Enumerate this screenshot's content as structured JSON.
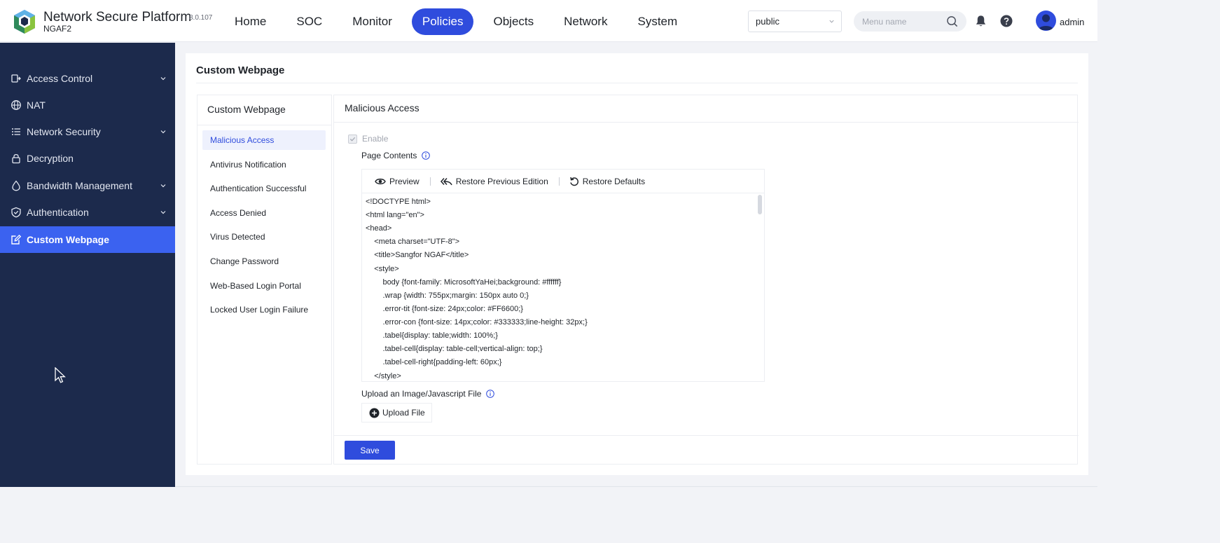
{
  "header": {
    "title": "Network Secure Platform",
    "subtitle": "NGAF2",
    "version": "8.0.107",
    "nav": [
      "Home",
      "SOC",
      "Monitor",
      "Policies",
      "Objects",
      "Network",
      "System"
    ],
    "active_nav": "Policies",
    "workspace_select": "public",
    "search_placeholder": "Menu name",
    "username": "admin"
  },
  "sidebar": {
    "items": [
      {
        "label": "Access Control",
        "icon": "access-control-icon",
        "expandable": true
      },
      {
        "label": "NAT",
        "icon": "globe-icon",
        "expandable": false
      },
      {
        "label": "Network Security",
        "icon": "list-icon",
        "expandable": true
      },
      {
        "label": "Decryption",
        "icon": "lock-icon",
        "expandable": false
      },
      {
        "label": "Bandwidth Management",
        "icon": "drop-icon",
        "expandable": true
      },
      {
        "label": "Authentication",
        "icon": "shield-check-icon",
        "expandable": true
      },
      {
        "label": "Custom Webpage",
        "icon": "edit-page-icon",
        "expandable": false
      }
    ],
    "active": "Custom Webpage"
  },
  "page": {
    "title": "Custom Webpage"
  },
  "subnav": {
    "title": "Custom Webpage",
    "items": [
      "Malicious Access",
      "Antivirus Notification",
      "Authentication Successful",
      "Access Denied",
      "Virus Detected",
      "Change Password",
      "Web-Based Login Portal",
      "Locked User Login Failure"
    ],
    "active": "Malicious Access"
  },
  "content": {
    "title": "Malicious Access",
    "enable_label": "Enable",
    "enable_checked": true,
    "page_contents_label": "Page Contents",
    "toolbar": {
      "preview": "Preview",
      "restore_previous": "Restore Previous Edition",
      "restore_defaults": "Restore Defaults"
    },
    "code_lines": [
      "<!DOCTYPE html>",
      "<html lang=\"en\">",
      "<head>",
      "    <meta charset=\"UTF-8\">",
      "    <title>Sangfor NGAF</title>",
      "    <style>",
      "        body {font-family: MicrosoftYaHei;background: #ffffff}",
      "        .wrap {width: 755px;margin: 150px auto 0;}",
      "        .error-tit {font-size: 24px;color: #FF6600;}",
      "        .error-con {font-size: 14px;color: #333333;line-height: 32px;}",
      "        .tabel{display: table;width: 100%;}",
      "        .tabel-cell{display: table-cell;vertical-align: top;}",
      "        .tabel-cell-right{padding-left: 60px;}",
      "    </style>"
    ],
    "upload_label": "Upload an Image/Javascript File",
    "upload_button": "Upload File",
    "save_button": "Save"
  },
  "colors": {
    "accent": "#2f4cdd",
    "sidebar_bg": "#1c2a4c",
    "sidebar_active": "#3b62f0"
  }
}
